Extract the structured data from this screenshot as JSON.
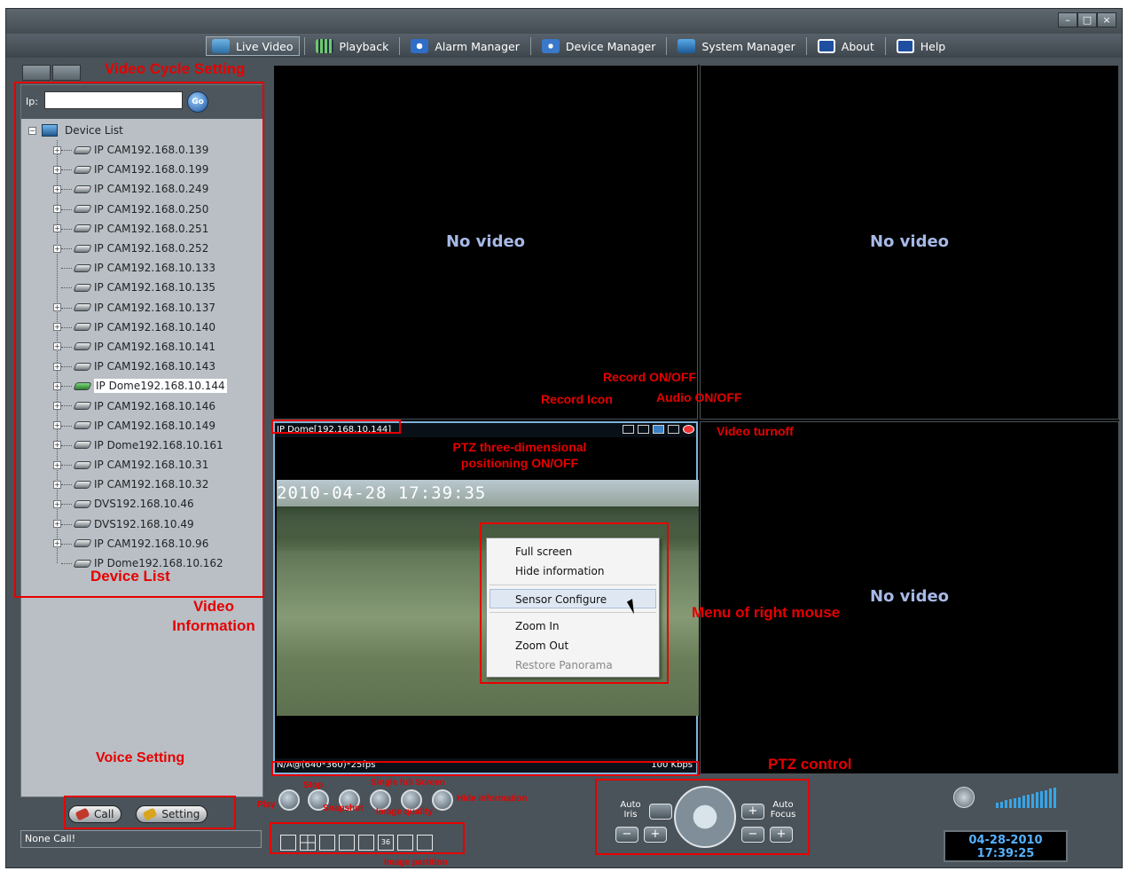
{
  "menu": {
    "items": [
      {
        "label": "Live Video",
        "icon": "live-video-icon",
        "active": true
      },
      {
        "label": "Playback",
        "icon": "playback-icon"
      },
      {
        "label": "Alarm Manager",
        "icon": "alarm-manager-icon"
      },
      {
        "label": "Device Manager",
        "icon": "device-manager-icon"
      },
      {
        "label": "System Manager",
        "icon": "system-manager-icon"
      },
      {
        "label": "About",
        "icon": "about-icon"
      },
      {
        "label": "Help",
        "icon": "help-icon"
      }
    ]
  },
  "ip_label": "Ip:",
  "ip_value": "",
  "go_label": "Go",
  "device_tree": {
    "root": "Device List",
    "items": [
      "IP CAM192.168.0.139",
      "IP CAM192.168.0.199",
      "IP CAM192.168.0.249",
      "IP CAM192.168.0.250",
      "IP CAM192.168.0.251",
      "IP CAM192.168.0.252",
      "IP CAM192.168.10.133",
      "IP CAM192.168.10.135",
      "IP CAM192.168.10.137",
      "IP CAM192.168.10.140",
      "IP CAM192.168.10.141",
      "IP CAM192.168.10.143",
      "IP Dome192.168.10.144",
      "IP CAM192.168.10.146",
      "IP CAM192.168.10.149",
      "IP Dome192.168.10.161",
      "IP CAM192.168.10.31",
      "IP CAM192.168.10.32",
      "DVS192.168.10.46",
      "DVS192.168.10.49",
      "IP CAM192.168.10.96",
      "IP Dome192.168.10.162"
    ],
    "selected": "IP Dome192.168.10.144"
  },
  "voice": {
    "call_label": "Call",
    "setting_label": "Setting"
  },
  "status": "None Call!",
  "panes": {
    "no_video": "No video",
    "active_title": "IP Dome[192.168.10.144]",
    "timestamp": "2010-04-28 17:39:35",
    "stream_info": "N/A@(640*360)*25fps",
    "bitrate": "100 Kbps"
  },
  "context_menu": {
    "items": [
      "Full screen",
      "Hide information",
      "Sensor Configure",
      "Zoom In",
      "Zoom Out",
      "Restore Panorama"
    ],
    "highlighted": "Sensor Configure",
    "disabled": "Restore Panorama"
  },
  "ptz": {
    "iris_label": "Auto Iris",
    "focus_label": "Auto Focus",
    "minus": "−",
    "plus": "+"
  },
  "partition_36": "36",
  "clock": {
    "date": "04-28-2010",
    "time": "17:39:25"
  },
  "annotations": {
    "video_cycle": "Video Cycle Setting",
    "device_list": "Device List",
    "video_info": "Video Information",
    "voice_setting": "Voice Setting",
    "record_onoff": "Record ON/OFF",
    "record_icon": "Record Icon",
    "audio_onoff": "Audio ON/OFF",
    "video_turnoff": "Video turnoff",
    "ptz_3d": "PTZ three-dimensional positioning ON/OFF",
    "menu_right": "Menu of right mouse",
    "ptz_control": "PTZ control",
    "play": "Play",
    "stop": "Stop",
    "snapshot": "Snapshot",
    "single_full": "Single full Screen",
    "image_quality": "Image quality",
    "hide_info": "Hide information",
    "image_partition": "Image partition"
  },
  "colors": {
    "annotation": "#e60000",
    "no_video": "#a6b9e7",
    "clock": "#56b2ff"
  }
}
